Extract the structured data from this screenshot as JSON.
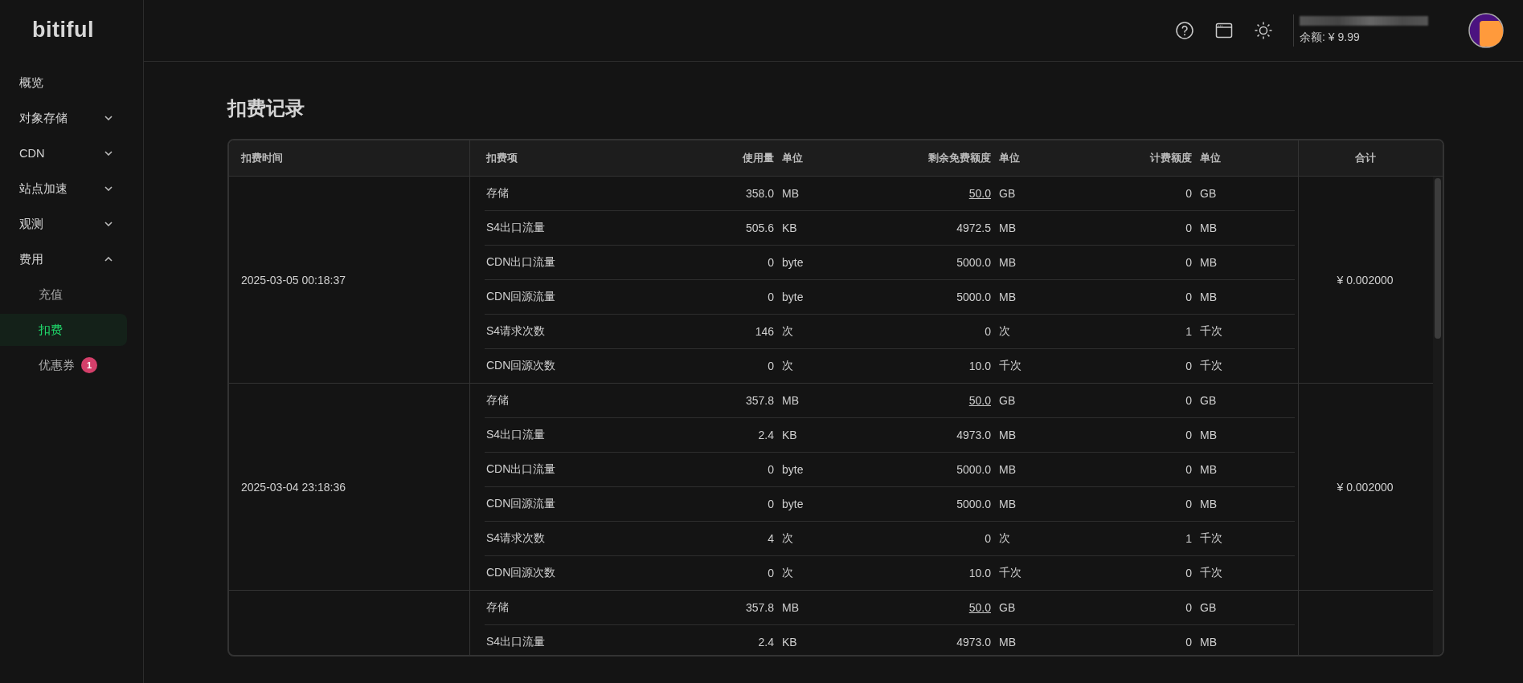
{
  "logo": "bitiful",
  "sidebar": {
    "items": [
      {
        "label": "概览",
        "kind": "link"
      },
      {
        "label": "对象存储",
        "kind": "group",
        "expanded": false
      },
      {
        "label": "CDN",
        "kind": "group",
        "expanded": false
      },
      {
        "label": "站点加速",
        "kind": "group",
        "expanded": false
      },
      {
        "label": "观测",
        "kind": "group",
        "expanded": false
      },
      {
        "label": "费用",
        "kind": "group",
        "expanded": true,
        "children": [
          {
            "label": "充值",
            "selected": false
          },
          {
            "label": "扣费",
            "selected": true
          },
          {
            "label": "优惠券",
            "selected": false,
            "badge": "1"
          }
        ]
      }
    ]
  },
  "header": {
    "balance": "余额: ¥ 9.99"
  },
  "page_title": "扣费记录",
  "table": {
    "columns": [
      "扣费时间",
      "扣费项",
      "使用量",
      "单位",
      "剩余免费额度",
      "单位",
      "计费额度",
      "单位",
      "合计"
    ],
    "groups": [
      {
        "time": "2025-03-05 00:18:37",
        "total": "¥ 0.002000",
        "rows": [
          {
            "item": "存储",
            "usage": "358.0",
            "usage_unit": "MB",
            "free": "50.0",
            "free_underlined": true,
            "free_unit": "GB",
            "billed": "0",
            "billed_unit": "GB"
          },
          {
            "item": "S4出口流量",
            "usage": "505.6",
            "usage_unit": "KB",
            "free": "4972.5",
            "free_underlined": false,
            "free_unit": "MB",
            "billed": "0",
            "billed_unit": "MB"
          },
          {
            "item": "CDN出口流量",
            "usage": "0",
            "usage_unit": "byte",
            "free": "5000.0",
            "free_underlined": false,
            "free_unit": "MB",
            "billed": "0",
            "billed_unit": "MB"
          },
          {
            "item": "CDN回源流量",
            "usage": "0",
            "usage_unit": "byte",
            "free": "5000.0",
            "free_underlined": false,
            "free_unit": "MB",
            "billed": "0",
            "billed_unit": "MB"
          },
          {
            "item": "S4请求次数",
            "usage": "146",
            "usage_unit": "次",
            "free": "0",
            "free_underlined": false,
            "free_unit": "次",
            "billed": "1",
            "billed_unit": "千次"
          },
          {
            "item": "CDN回源次数",
            "usage": "0",
            "usage_unit": "次",
            "free": "10.0",
            "free_underlined": false,
            "free_unit": "千次",
            "billed": "0",
            "billed_unit": "千次"
          }
        ]
      },
      {
        "time": "2025-03-04 23:18:36",
        "total": "¥ 0.002000",
        "rows": [
          {
            "item": "存储",
            "usage": "357.8",
            "usage_unit": "MB",
            "free": "50.0",
            "free_underlined": true,
            "free_unit": "GB",
            "billed": "0",
            "billed_unit": "GB"
          },
          {
            "item": "S4出口流量",
            "usage": "2.4",
            "usage_unit": "KB",
            "free": "4973.0",
            "free_underlined": false,
            "free_unit": "MB",
            "billed": "0",
            "billed_unit": "MB"
          },
          {
            "item": "CDN出口流量",
            "usage": "0",
            "usage_unit": "byte",
            "free": "5000.0",
            "free_underlined": false,
            "free_unit": "MB",
            "billed": "0",
            "billed_unit": "MB"
          },
          {
            "item": "CDN回源流量",
            "usage": "0",
            "usage_unit": "byte",
            "free": "5000.0",
            "free_underlined": false,
            "free_unit": "MB",
            "billed": "0",
            "billed_unit": "MB"
          },
          {
            "item": "S4请求次数",
            "usage": "4",
            "usage_unit": "次",
            "free": "0",
            "free_underlined": false,
            "free_unit": "次",
            "billed": "1",
            "billed_unit": "千次"
          },
          {
            "item": "CDN回源次数",
            "usage": "0",
            "usage_unit": "次",
            "free": "10.0",
            "free_underlined": false,
            "free_unit": "千次",
            "billed": "0",
            "billed_unit": "千次"
          }
        ]
      },
      {
        "rows": [
          {
            "item": "存储",
            "usage": "357.8",
            "usage_unit": "MB",
            "free": "50.0",
            "free_underlined": true,
            "free_unit": "GB",
            "billed": "0",
            "billed_unit": "GB"
          },
          {
            "item": "S4出口流量",
            "usage": "2.4",
            "usage_unit": "KB",
            "free": "4973.0",
            "free_underlined": false,
            "free_unit": "MB",
            "billed": "0",
            "billed_unit": "MB"
          }
        ]
      }
    ]
  }
}
